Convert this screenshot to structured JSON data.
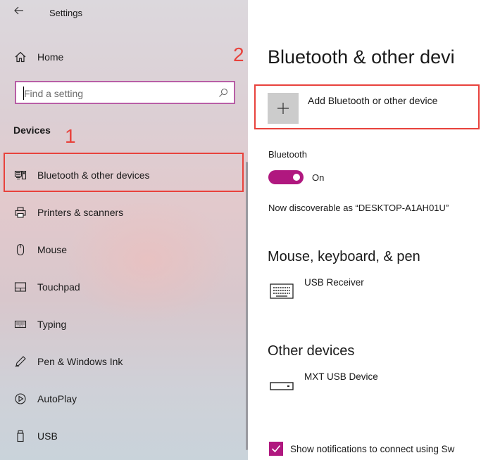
{
  "window": {
    "title": "Settings",
    "back_icon": "back-arrow-icon"
  },
  "sidebar": {
    "home_label": "Home",
    "search_placeholder": "Find a setting",
    "section_title": "Devices",
    "items": [
      {
        "label": "Bluetooth & other devices",
        "icon": "bluetooth-devices-icon",
        "selected": true
      },
      {
        "label": "Printers & scanners",
        "icon": "printer-icon"
      },
      {
        "label": "Mouse",
        "icon": "mouse-icon"
      },
      {
        "label": "Touchpad",
        "icon": "touchpad-icon"
      },
      {
        "label": "Typing",
        "icon": "keyboard-icon"
      },
      {
        "label": "Pen & Windows Ink",
        "icon": "pen-icon"
      },
      {
        "label": "AutoPlay",
        "icon": "autoplay-icon"
      },
      {
        "label": "USB",
        "icon": "usb-icon"
      }
    ]
  },
  "annotations": {
    "step1": "1",
    "step2": "2",
    "color": "#e8423c"
  },
  "main": {
    "title": "Bluetooth & other devi",
    "add_device_label": "Add Bluetooth or other device",
    "bluetooth_label": "Bluetooth",
    "toggle_state": "On",
    "discoverable_text": "Now discoverable as “DESKTOP-A1AH01U”",
    "mouse_section_title": "Mouse, keyboard, & pen",
    "mouse_devices": [
      {
        "name": "USB Receiver",
        "icon": "keyboard-device-icon"
      }
    ],
    "other_section_title": "Other devices",
    "other_devices": [
      {
        "name": "MXT USB Device",
        "icon": "usb-device-icon"
      }
    ],
    "notification_label": "Show notifications to connect using Sw",
    "notification_checked": true
  },
  "colors": {
    "accent": "#b0187f",
    "search_border": "#b85ea6"
  }
}
